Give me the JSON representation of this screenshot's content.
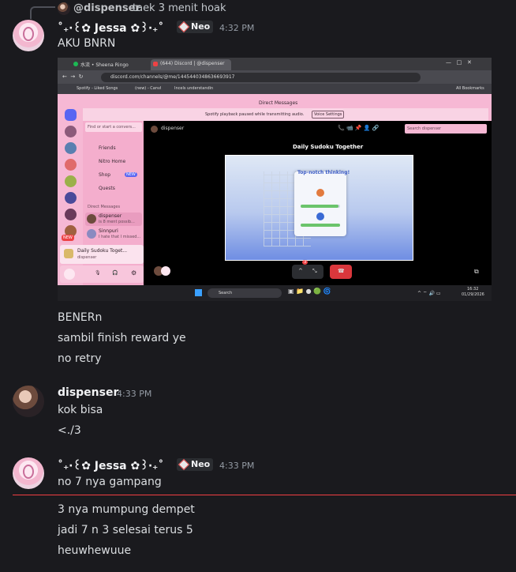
{
  "reply": {
    "author": "@dispenser",
    "text": "taek 3 menit hoak"
  },
  "group1": {
    "username": "˚₊‧꒰✿ Jessa ✿꒱‧₊˚",
    "tag": "Neo",
    "time": "4:32 PM",
    "messages": [
      "AKU BNRN",
      "BENERn",
      "sambil finish reward ye",
      "no retry"
    ]
  },
  "group2": {
    "username": "dispenser",
    "time": "4:33 PM",
    "messages": [
      "kok bisa",
      "<./3"
    ]
  },
  "group3": {
    "username": "˚₊‧꒰✿ Jessa ✿꒱‧₊˚",
    "tag": "Neo",
    "time": "4:33 PM",
    "messages": [
      "no 7 nya gampang",
      "3 nya mumpung dempet",
      "jadi 7 n 3 selesai terus 5",
      "heuwhewuue"
    ]
  },
  "screenshot": {
    "tab1": "水流 • Sheena Ringo",
    "tab2": "(644) Discord | @dispenser",
    "url": "discord.com/channels/@me/1445440348636693917",
    "bookmarks": [
      "Spotify - Liked Songs",
      "(new) - Canvl",
      "Incels understandin"
    ],
    "all_bookmarks": "All Bookmarks",
    "header": "Direct Messages",
    "notice": "Spotify playback paused while transmitting audio.",
    "notice_button": "Voice Settings",
    "search_placeholder": "Find or start a convers...",
    "nav": [
      "Friends",
      "Nitro Home",
      "Shop",
      "Quests"
    ],
    "shop_badge": "NEW",
    "dm_header": "Direct Messages",
    "dm1_name": "dispenser",
    "dm1_status": "is 8 ment possib...",
    "dm2_name": "Sinnpuri",
    "dm2_status": "I hate that I missed...",
    "activity_title": "Daily Sudoku Toget...",
    "activity_user": "dispenser",
    "channel_name": "dispenser",
    "channel_search": "Search dispenser",
    "game_title": "Daily Sudoku Together",
    "game_toast": "Top-notch thinking!",
    "taskbar_search": "Search",
    "clock_time": "16:32",
    "clock_date": "01/29/2026",
    "new_badge": "NEW",
    "voice_badge": "3"
  }
}
